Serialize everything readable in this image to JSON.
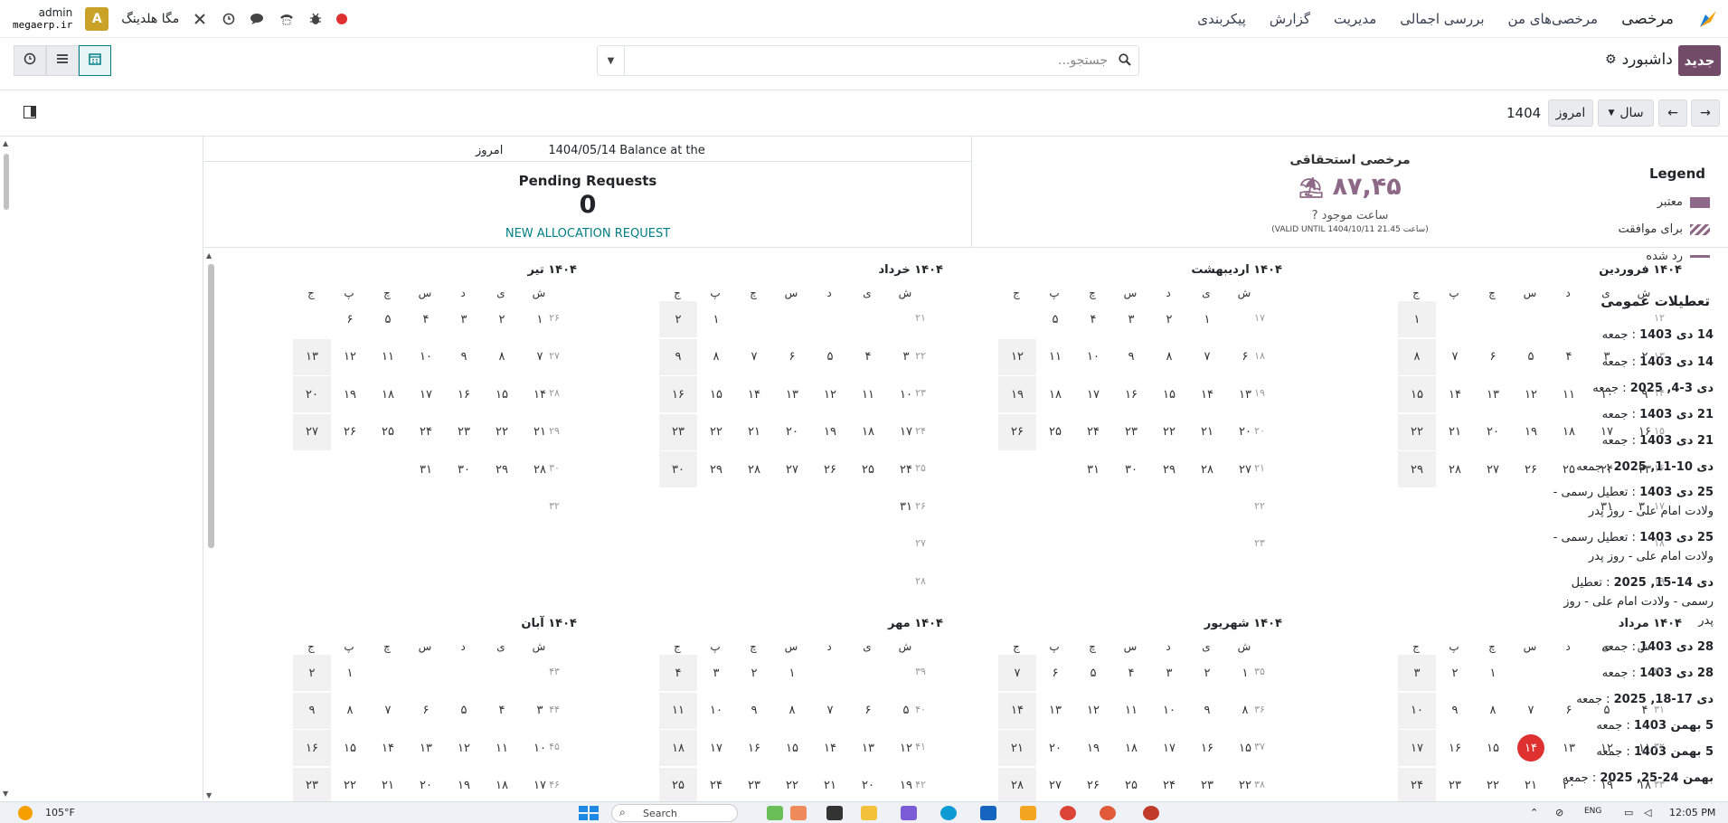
{
  "nav": {
    "brand": "مرخصی",
    "menu": [
      "مرخصی‌های من",
      "بررسی اجمالی",
      "مدیریت",
      "گزارش",
      "پیکربندی"
    ],
    "company": "مگا هلدینگ",
    "avatar_letter": "A",
    "user": "admin",
    "db": "megaerp.ir"
  },
  "control": {
    "new_label": "جدید",
    "breadcrumb": "داشبورد",
    "search_placeholder": "جستجو..."
  },
  "toolbar": {
    "today_label": "امروز",
    "scale_label": "سال",
    "year": "1404"
  },
  "legend": {
    "title": "Legend",
    "items": [
      {
        "label": "معتبر",
        "color": "#8e6887"
      },
      {
        "label": "برای موافقت",
        "color": "#8e6887"
      },
      {
        "label": "رد شده",
        "color": "#8e6887"
      }
    ]
  },
  "holidays": {
    "title": "تعطیلات عمومی",
    "items": [
      {
        "date": "14 دی 1403",
        "name": "جمعه"
      },
      {
        "date": "14 دی 1403",
        "name": "جمعه"
      },
      {
        "date": "دی 3-4, 2025",
        "name": "جمعه"
      },
      {
        "date": "21 دی 1403",
        "name": "جمعه"
      },
      {
        "date": "21 دی 1403",
        "name": "جمعه"
      },
      {
        "date": "دی 10-11, 2025",
        "name": "جمعه"
      },
      {
        "date": "25 دی 1403",
        "name": "تعطیل رسمی - ولادت امام علی - روز پدر"
      },
      {
        "date": "25 دی 1403",
        "name": "تعطیل رسمی - ولادت امام علی - روز پدر"
      },
      {
        "date": "دی 14-15, 2025",
        "name": "تعطیل رسمی - ولادت امام علی - روز پدر"
      },
      {
        "date": "28 دی 1403",
        "name": "جمعه"
      },
      {
        "date": "28 دی 1403",
        "name": "جمعه"
      },
      {
        "date": "دی 17-18, 2025",
        "name": "جمعه"
      },
      {
        "date": "5 بهمن 1403",
        "name": "جمعه"
      },
      {
        "date": "5 بهمن 1403",
        "name": "جمعه"
      },
      {
        "date": "بهمن 24-25, 2025",
        "name": "جمعه"
      }
    ]
  },
  "stats": {
    "mandatory": {
      "title": "مرخصی استحقاقی",
      "value": "۸۷,۴۵",
      "unit": "ساعت موجود",
      "valid": "(VALID UNTIL 1404/10/11 ساعت 21.45)"
    },
    "balance_label": "Balance at the",
    "balance_date": "1404/05/14",
    "balance_today": "امروز",
    "pending_title": "Pending Requests",
    "pending_value": "0",
    "allocation_link": "NEW ALLOCATION REQUEST"
  },
  "weekdays": [
    "ش",
    "ی",
    "د",
    "س",
    "چ",
    "پ",
    "ج"
  ],
  "months": [
    {
      "title": "۱۴۰۴ فروردین",
      "weeks": [
        "۱۲",
        "۱۳",
        "۱۴",
        "۱۵",
        "۱۶",
        "۱۷",
        "۱۸",
        "۱۹"
      ],
      "rows": [
        [
          "",
          "",
          "",
          "",
          "",
          "",
          "۱"
        ],
        [
          "۲",
          "۳",
          "۴",
          "۵",
          "۶",
          "۷",
          "۸"
        ],
        [
          "۹",
          "۱۰",
          "۱۱",
          "۱۲",
          "۱۳",
          "۱۴",
          "۱۵"
        ],
        [
          "۱۶",
          "۱۷",
          "۱۸",
          "۱۹",
          "۲۰",
          "۲۱",
          "۲۲"
        ],
        [
          "۲۳",
          "۲۴",
          "۲۵",
          "۲۶",
          "۲۷",
          "۲۸",
          "۲۹"
        ],
        [
          "۳۰",
          "۳۱",
          "",
          "",
          "",
          "",
          ""
        ]
      ]
    },
    {
      "title": "۱۴۰۴ اردیبهشت",
      "weeks": [
        "۱۷",
        "۱۸",
        "۱۹",
        "۲۰",
        "۲۱",
        "۲۲",
        "۲۳"
      ],
      "rows": [
        [
          "",
          "۱",
          "۲",
          "۳",
          "۴",
          "۵"
        ],
        [
          "۶",
          "۷",
          "۸",
          "۹",
          "۱۰",
          "۱۱",
          "۱۲"
        ],
        [
          "۱۳",
          "۱۴",
          "۱۵",
          "۱۶",
          "۱۷",
          "۱۸",
          "۱۹"
        ],
        [
          "۲۰",
          "۲۱",
          "۲۲",
          "۲۳",
          "۲۴",
          "۲۵",
          "۲۶"
        ],
        [
          "۲۷",
          "۲۸",
          "۲۹",
          "۳۰",
          "۳۱",
          "",
          ""
        ]
      ]
    },
    {
      "title": "۱۴۰۴ خرداد",
      "weeks": [
        "۲۱",
        "۲۲",
        "۲۳",
        "۲۴",
        "۲۵",
        "۲۶",
        "۲۷",
        "۲۸"
      ],
      "rows": [
        [
          "",
          "",
          "",
          "",
          "",
          "۱",
          "۲"
        ],
        [
          "۳",
          "۴",
          "۵",
          "۶",
          "۷",
          "۸",
          "۹"
        ],
        [
          "۱۰",
          "۱۱",
          "۱۲",
          "۱۳",
          "۱۴",
          "۱۵",
          "۱۶"
        ],
        [
          "۱۷",
          "۱۸",
          "۱۹",
          "۲۰",
          "۲۱",
          "۲۲",
          "۲۳"
        ],
        [
          "۲۴",
          "۲۵",
          "۲۶",
          "۲۷",
          "۲۸",
          "۲۹",
          "۳۰"
        ],
        [
          "۳۱",
          "",
          "",
          "",
          "",
          "",
          ""
        ]
      ]
    },
    {
      "title": "۱۴۰۴ تیر",
      "weeks": [
        "۲۶",
        "۲۷",
        "۲۸",
        "۲۹",
        "۳۰",
        "۳۲"
      ],
      "rows": [
        [
          "۱",
          "۲",
          "۳",
          "۴",
          "۵",
          "۶"
        ],
        [
          "۷",
          "۸",
          "۹",
          "۱۰",
          "۱۱",
          "۱۲",
          "۱۳"
        ],
        [
          "۱۴",
          "۱۵",
          "۱۶",
          "۱۷",
          "۱۸",
          "۱۹",
          "۲۰"
        ],
        [
          "۲۱",
          "۲۲",
          "۲۳",
          "۲۴",
          "۲۵",
          "۲۶",
          "۲۷"
        ],
        [
          "۲۸",
          "۲۹",
          "۳۰",
          "۳۱",
          "",
          "",
          ""
        ]
      ]
    },
    {
      "title": "۱۴۰۴ مرداد",
      "weeks": [
        "۳۰",
        "۳۱",
        "۳۲",
        "۳۳"
      ],
      "rows": [
        [
          "",
          "",
          "",
          "",
          "۱",
          "۲",
          "۳"
        ],
        [
          "۴",
          "۵",
          "۶",
          "۷",
          "۸",
          "۹",
          "۱۰"
        ],
        [
          "۱۱",
          "۱۲",
          "۱۳",
          "۱۴",
          "۱۵",
          "۱۶",
          "۱۷"
        ],
        [
          "۱۸",
          "۱۹",
          "۲۰",
          "۲۱",
          "۲۲",
          "۲۳",
          "۲۴"
        ]
      ]
    },
    {
      "title": "۱۴۰۴ شهریور",
      "weeks": [
        "۳۵",
        "۳۶",
        "۳۷",
        "۳۸"
      ],
      "rows": [
        [
          "۱",
          "۲",
          "۳",
          "۴",
          "۵",
          "۶",
          "۷"
        ],
        [
          "۸",
          "۹",
          "۱۰",
          "۱۱",
          "۱۲",
          "۱۳",
          "۱۴"
        ],
        [
          "۱۵",
          "۱۶",
          "۱۷",
          "۱۸",
          "۱۹",
          "۲۰",
          "۲۱"
        ],
        [
          "۲۲",
          "۲۳",
          "۲۴",
          "۲۵",
          "۲۶",
          "۲۷",
          "۲۸"
        ]
      ]
    },
    {
      "title": "۱۴۰۴ مهر",
      "weeks": [
        "۳۹",
        "۴۰",
        "۴۱",
        "۴۲"
      ],
      "rows": [
        [
          "",
          "",
          "",
          "۱",
          "۲",
          "۳",
          "۴"
        ],
        [
          "۵",
          "۶",
          "۷",
          "۸",
          "۹",
          "۱۰",
          "۱۱"
        ],
        [
          "۱۲",
          "۱۳",
          "۱۴",
          "۱۵",
          "۱۶",
          "۱۷",
          "۱۸"
        ],
        [
          "۱۹",
          "۲۰",
          "۲۱",
          "۲۲",
          "۲۳",
          "۲۴",
          "۲۵"
        ]
      ]
    },
    {
      "title": "۱۴۰۴ آبان",
      "weeks": [
        "۴۳",
        "۴۴",
        "۴۵",
        "۴۶"
      ],
      "rows": [
        [
          "",
          "",
          "",
          "",
          "",
          "۱",
          "۲"
        ],
        [
          "۳",
          "۴",
          "۵",
          "۶",
          "۷",
          "۸",
          "۹"
        ],
        [
          "۱۰",
          "۱۱",
          "۱۲",
          "۱۳",
          "۱۴",
          "۱۵",
          "۱۶"
        ],
        [
          "۱۷",
          "۱۸",
          "۱۹",
          "۲۰",
          "۲۱",
          "۲۲",
          "۲۳"
        ]
      ]
    }
  ],
  "today_day": "۱۴",
  "taskbar": {
    "weather": "105°F",
    "search": "Search",
    "lang": "ENG",
    "time": "12:05 PM"
  }
}
